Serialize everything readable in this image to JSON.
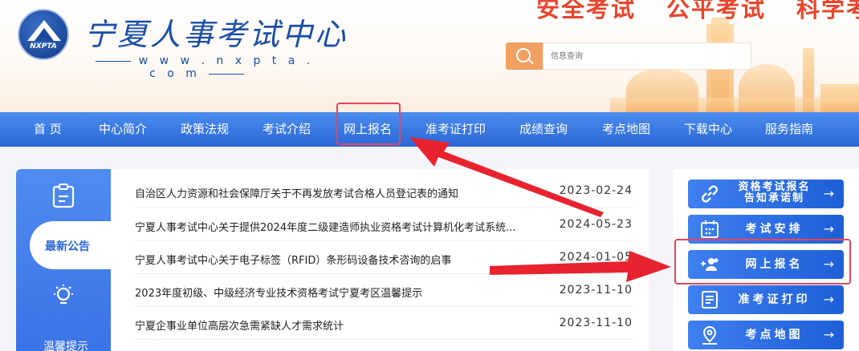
{
  "header": {
    "logo_emblem_text": "NXPTA",
    "site_title": "宁夏人事考试中心",
    "site_url": "w w w . n x p t a . c o m",
    "slogans": [
      "安全考试",
      "公平考试",
      "科学考试"
    ],
    "search": {
      "placeholder": "信息查询"
    }
  },
  "nav": {
    "items": [
      "首 页",
      "中心简介",
      "政策法规",
      "考试介绍",
      "网上报名",
      "准考证打印",
      "成绩查询",
      "考点地图",
      "下载中心",
      "服务指南"
    ]
  },
  "left_tabs": {
    "items": [
      {
        "label": "",
        "icon": "clipboard-icon"
      },
      {
        "label": "最新公告",
        "active": true
      },
      {
        "label": "",
        "icon": "lightbulb-icon"
      },
      {
        "label": "温馨提示"
      }
    ]
  },
  "news": {
    "items": [
      {
        "title": "自治区人力资源和社会保障厅关于不再发放考试合格人员登记表的通知",
        "date": "2023-02-24"
      },
      {
        "title": "宁夏人事考试中心关于提供2024年度二级建造师执业资格考试计算机化考试系统...",
        "date": "2024-05-23"
      },
      {
        "title": "宁夏人事考试中心关于电子标签（RFID）条形码设备技术咨询的启事",
        "date": "2024-01-05"
      },
      {
        "title": "2023年度初级、中级经济专业技术资格考试宁夏考区温馨提示",
        "date": "2023-11-10"
      },
      {
        "title": "宁夏企事业单位高层次急需紧缺人才需求统计",
        "date": "2023-11-10"
      }
    ]
  },
  "services": {
    "items": [
      {
        "label_line1": "资格考试报名",
        "label_line2": "告知承诺制",
        "icon": "link-icon",
        "arrow": "→"
      },
      {
        "label": "考试安排",
        "icon": "calendar-icon",
        "arrow": "→"
      },
      {
        "label": "网上报名",
        "icon": "user-add-icon",
        "arrow": "→"
      },
      {
        "label": "准考证打印",
        "icon": "document-icon",
        "arrow": "→"
      },
      {
        "label": "考点地图",
        "icon": "map-pin-icon",
        "arrow": "→"
      }
    ]
  },
  "colors": {
    "brand_blue": "#1a4ea8",
    "nav_blue": "#2a67d6",
    "slogan_red": "#e8452c",
    "highlight_red": "#e8455a",
    "search_orange": "#f0a060"
  }
}
